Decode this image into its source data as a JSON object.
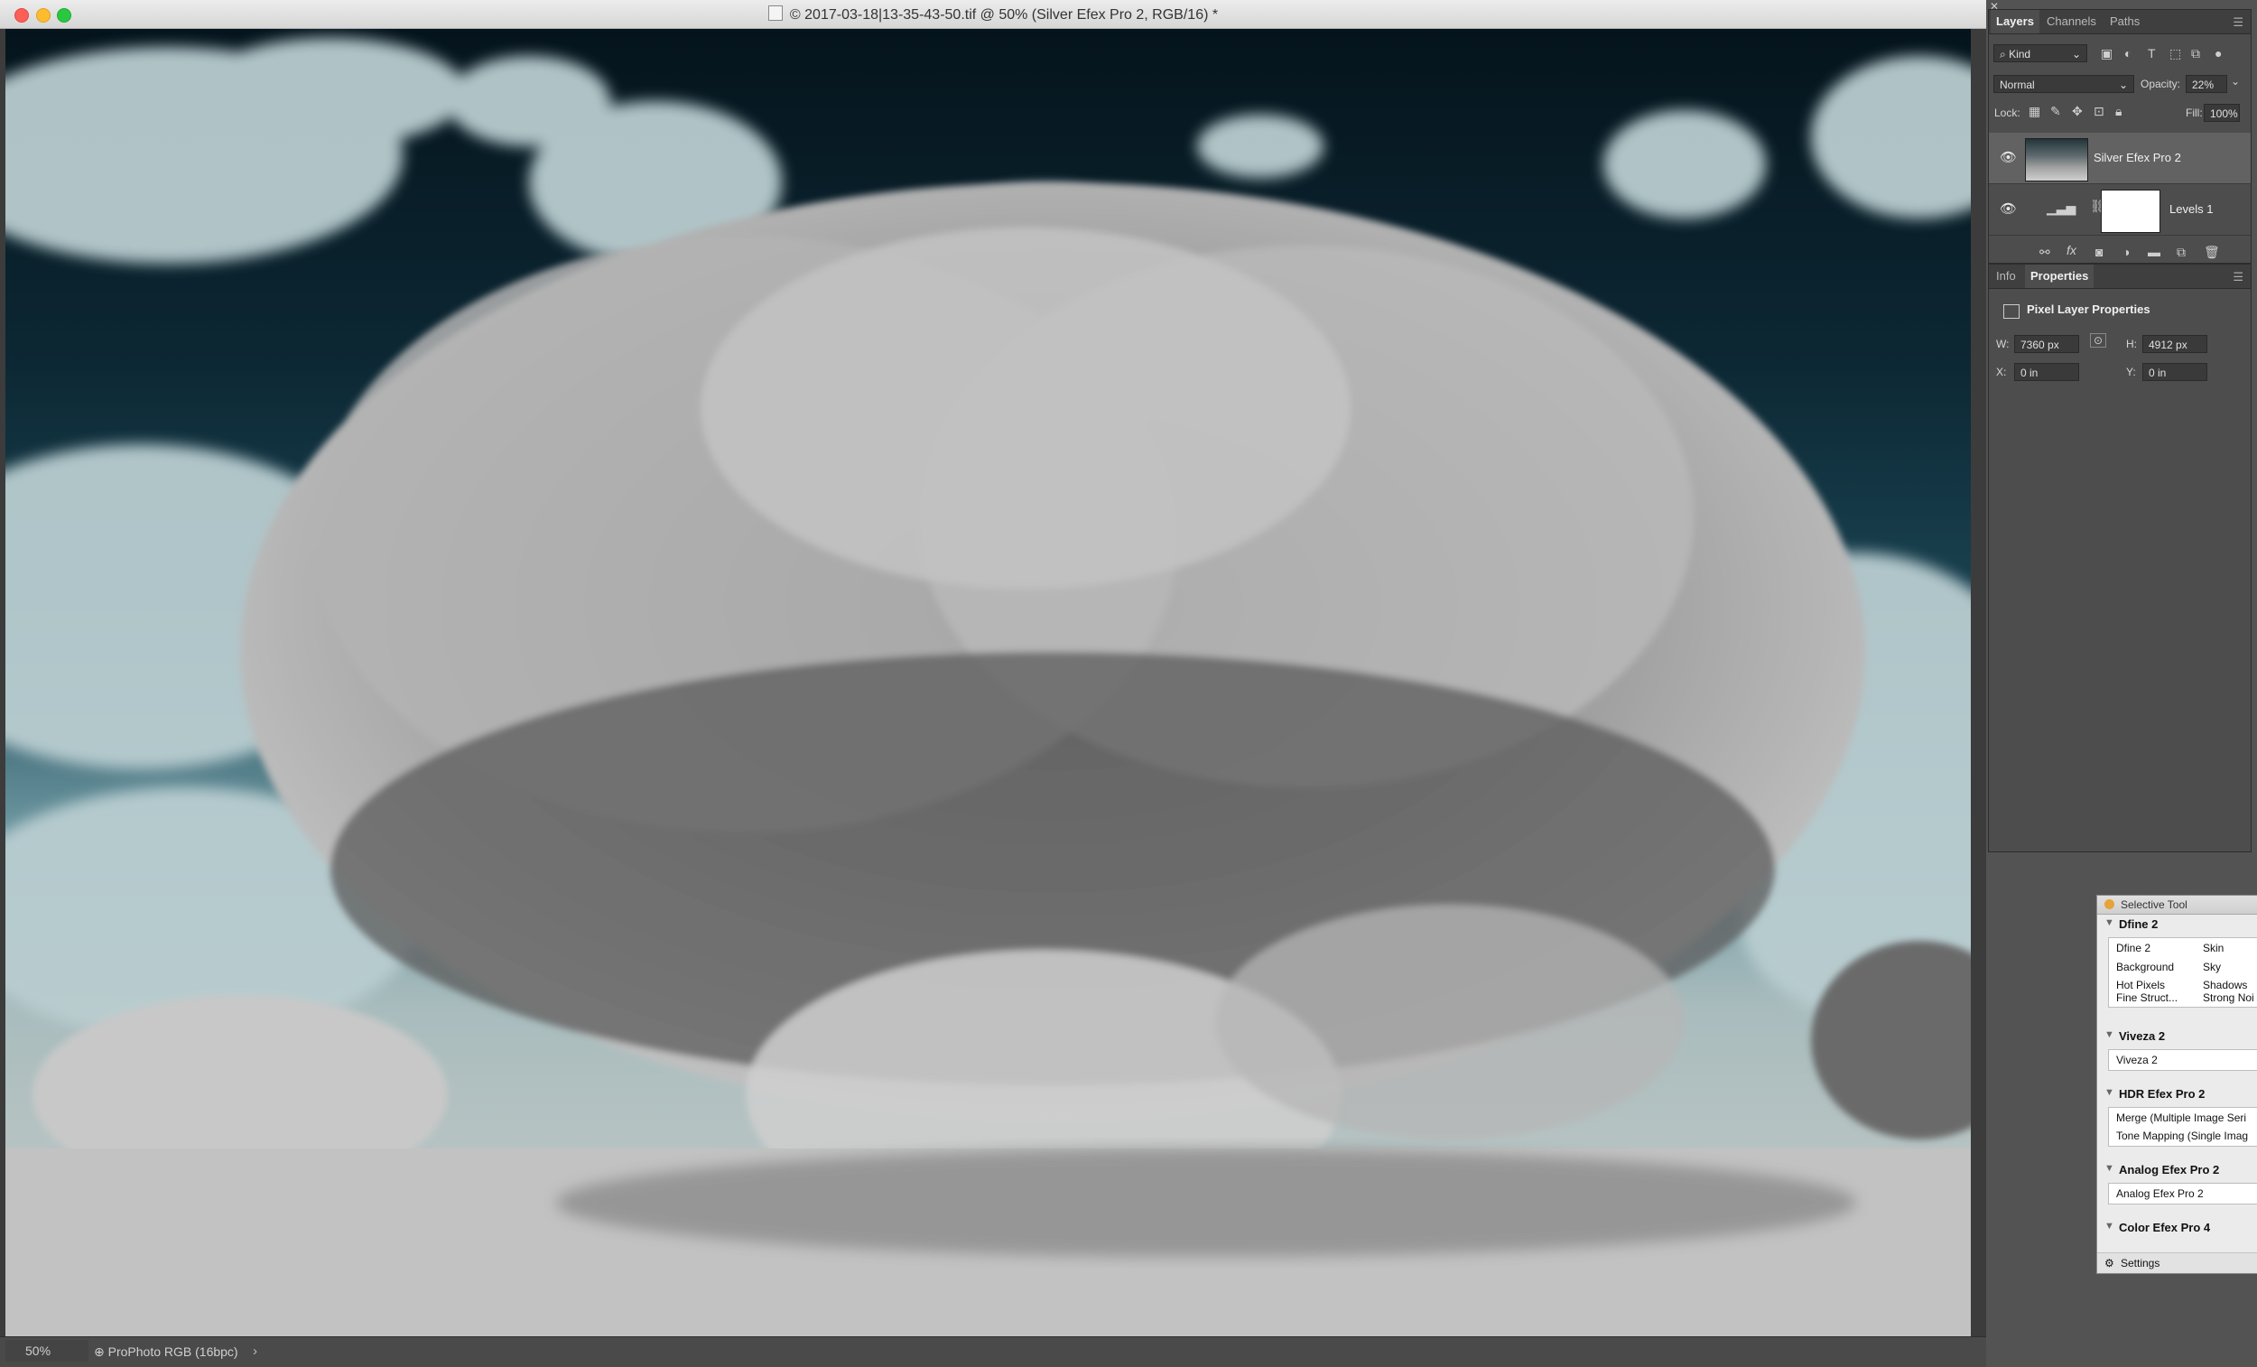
{
  "window": {
    "title": "© 2017-03-18|13-35-43-50.tif @ 50% (Silver Efex Pro 2, RGB/16) *"
  },
  "status_bar": {
    "zoom": "50%",
    "profile": "ProPhoto RGB (16bpc)",
    "arrow": "›"
  },
  "layers_panel": {
    "tabs": [
      "Layers",
      "Channels",
      "Paths"
    ],
    "filter_kind": "Kind",
    "blend_mode": "Normal",
    "opacity_label": "Opacity:",
    "opacity_value": "22%",
    "lock_label": "Lock:",
    "fill_label": "Fill:",
    "fill_value": "100%",
    "layers": [
      {
        "name": "Silver Efex Pro 2",
        "selected": true
      },
      {
        "name": "Levels 1",
        "selected": false
      }
    ],
    "footer_icons": [
      "link-icon",
      "fx-icon",
      "mask-icon",
      "adjustment-icon",
      "folder-icon",
      "new-layer-icon",
      "trash-icon"
    ]
  },
  "properties_panel": {
    "tabs": [
      "Info",
      "Properties"
    ],
    "title": "Pixel Layer Properties",
    "w_label": "W:",
    "w_value": "7360 px",
    "h_label": "H:",
    "h_value": "4912 px",
    "x_label": "X:",
    "x_value": "0 in",
    "y_label": "Y:",
    "y_value": "0 in"
  },
  "selective_tool": {
    "title": "Selective Tool",
    "groups": [
      {
        "name": "Dfine 2",
        "items": [
          "Dfine 2",
          "Skin",
          "Background",
          "Sky",
          "Hot Pixels",
          "Shadows",
          "Fine Struct...",
          "Strong Noi"
        ]
      },
      {
        "name": "Viveza 2",
        "items": [
          "Viveza 2"
        ]
      },
      {
        "name": "HDR Efex Pro 2",
        "items": [
          "Merge (Multiple Image Seri",
          "Tone Mapping (Single Imag"
        ]
      },
      {
        "name": "Analog Efex Pro 2",
        "items": [
          "Analog Efex Pro 2"
        ]
      },
      {
        "name": "Color Efex Pro 4",
        "items": []
      }
    ],
    "settings_label": "Settings"
  },
  "colors": {
    "panel_bg": "#4d4d4d",
    "selected_layer": "#626262",
    "close": "#fc5f57",
    "minimize": "#fdbc2e",
    "maximize": "#29c840"
  }
}
